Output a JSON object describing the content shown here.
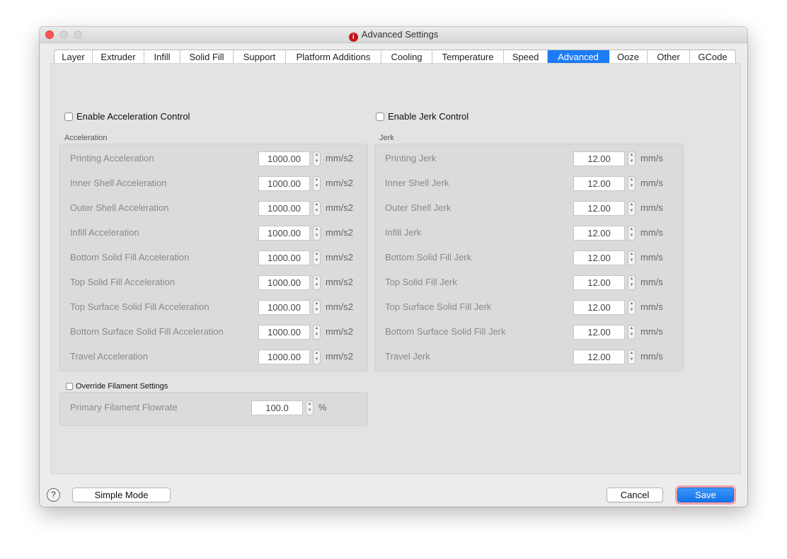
{
  "window": {
    "title": "Advanced Settings",
    "app_icon_glyph": "i"
  },
  "tabs": [
    {
      "label": "Layer",
      "active": false
    },
    {
      "label": "Extruder",
      "active": false
    },
    {
      "label": "Infill",
      "active": false
    },
    {
      "label": "Solid Fill",
      "active": false
    },
    {
      "label": "Support",
      "active": false
    },
    {
      "label": "Platform Additions",
      "active": false
    },
    {
      "label": "Cooling",
      "active": false
    },
    {
      "label": "Temperature",
      "active": false
    },
    {
      "label": "Speed",
      "active": false
    },
    {
      "label": "Advanced",
      "active": true
    },
    {
      "label": "Ooze",
      "active": false
    },
    {
      "label": "Other",
      "active": false
    },
    {
      "label": "GCode",
      "active": false
    }
  ],
  "acceleration": {
    "enable_label": "Enable Acceleration Control",
    "enabled": false,
    "group_label": "Acceleration",
    "unit": "mm/s2",
    "rows": [
      {
        "label": "Printing Acceleration",
        "value": "1000.00"
      },
      {
        "label": "Inner Shell Acceleration",
        "value": "1000.00"
      },
      {
        "label": "Outer Shell Acceleration",
        "value": "1000.00"
      },
      {
        "label": "Infill Acceleration",
        "value": "1000.00"
      },
      {
        "label": "Bottom Solid Fill Acceleration",
        "value": "1000.00"
      },
      {
        "label": "Top Solid Fill Acceleration",
        "value": "1000.00"
      },
      {
        "label": "Top Surface Solid Fill Acceleration",
        "value": "1000.00"
      },
      {
        "label": "Bottom Surface Solid Fill Acceleration",
        "value": "1000.00"
      },
      {
        "label": "Travel Acceleration",
        "value": "1000.00"
      }
    ]
  },
  "jerk": {
    "enable_label": "Enable Jerk Control",
    "enabled": false,
    "group_label": "Jerk",
    "unit": "mm/s",
    "rows": [
      {
        "label": "Printing Jerk",
        "value": "12.00"
      },
      {
        "label": "Inner Shell Jerk",
        "value": "12.00"
      },
      {
        "label": "Outer Shell Jerk",
        "value": "12.00"
      },
      {
        "label": "Infill Jerk",
        "value": "12.00"
      },
      {
        "label": "Bottom Solid Fill Jerk",
        "value": "12.00"
      },
      {
        "label": "Top Solid Fill Jerk",
        "value": "12.00"
      },
      {
        "label": "Top Surface Solid Fill Jerk",
        "value": "12.00"
      },
      {
        "label": "Bottom Surface Solid Fill Jerk",
        "value": "12.00"
      },
      {
        "label": "Travel Jerk",
        "value": "12.00"
      }
    ]
  },
  "filament": {
    "override_label": "Override Filament Settings",
    "enabled": false,
    "flowrate_label": "Primary Filament Flowrate",
    "flowrate_value": "100.0",
    "flowrate_unit": "%"
  },
  "footer": {
    "help_glyph": "?",
    "simple_mode_label": "Simple Mode",
    "cancel_label": "Cancel",
    "save_label": "Save"
  },
  "colors": {
    "accent": "#1b7cf5",
    "close_button": "#fc5753",
    "focus_ring": "#f2a1a7"
  },
  "icons": {
    "help": "question-circle-icon",
    "stepper": "chevron-up-down-icon",
    "app": "app-logo-icon"
  }
}
